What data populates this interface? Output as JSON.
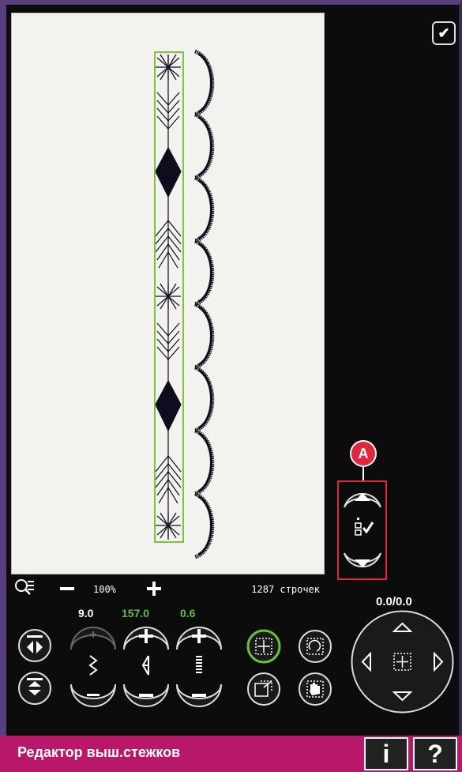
{
  "zoom": {
    "value": "100%",
    "stitch_count": "1287 строчек"
  },
  "params": {
    "width": "9.0",
    "length": "157.0",
    "density": "0.6"
  },
  "position": {
    "readout": "0.0/0.0"
  },
  "callout": {
    "label": "A"
  },
  "footer": {
    "title": "Редактор выш.стежков",
    "info_label": "i",
    "help_label": "?"
  },
  "colors": {
    "accent": "#b9186a",
    "highlight": "#e0263d",
    "selection": "#7dc23c",
    "value_green": "#5fbf4a"
  },
  "icons": [
    "checkmark-icon",
    "zoom-options-icon",
    "zoom-out-icon",
    "zoom-in-icon",
    "mirror-side-icon",
    "mirror-end-icon",
    "stitch-width-icon",
    "stitch-length-icon",
    "stitch-density-icon",
    "move-icon",
    "rotate-icon",
    "scale-icon",
    "pan-icon",
    "arrow-up-icon",
    "arrow-down-icon",
    "arrow-left-icon",
    "arrow-right-icon",
    "center-icon"
  ]
}
